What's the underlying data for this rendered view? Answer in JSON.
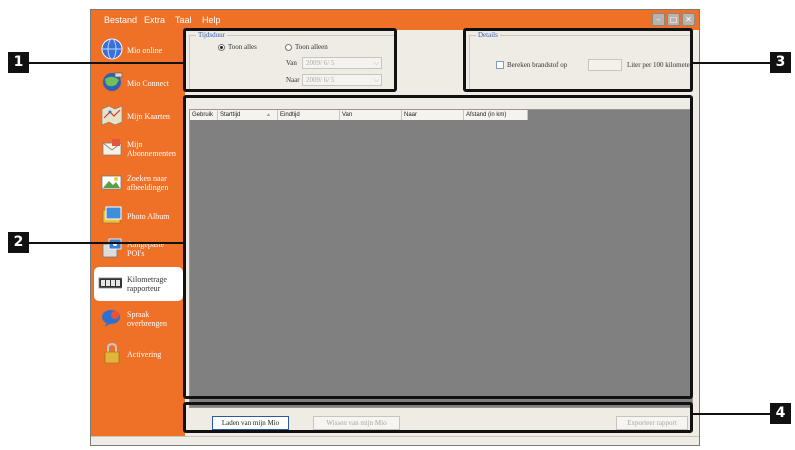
{
  "menubar": {
    "items": [
      "Bestand",
      "Extra",
      "Taal",
      "Help"
    ]
  },
  "sidebar": {
    "items": [
      {
        "label": "Mio online",
        "icon": "globe-icon"
      },
      {
        "label": "Mio Connect",
        "icon": "satellite-globe-icon"
      },
      {
        "label": "Mijn Kaarten",
        "icon": "map-icon"
      },
      {
        "label": "Mijn\nAbonnementen",
        "icon": "envelope-icon"
      },
      {
        "label": "Zoeken naar\nafbeeldingen",
        "icon": "photo-search-icon"
      },
      {
        "label": "Photo Album",
        "icon": "photo-album-icon"
      },
      {
        "label": "Aangepaste\nPOI's",
        "icon": "poi-icon"
      },
      {
        "label": "Kilometrage\nrapporteur",
        "icon": "odometer-icon",
        "active": true
      },
      {
        "label": "Spraak\noverbrengen",
        "icon": "speech-bubble-icon"
      },
      {
        "label": "Activering",
        "icon": "padlock-icon"
      }
    ]
  },
  "filter": {
    "legend": "Tijdsduur",
    "show_all": "Toon alles",
    "show_only": "Toon alleen",
    "from_label": "Van",
    "to_label": "Naar",
    "from_date": "2009/ 6/ 5",
    "to_date": "2009/ 6/ 5",
    "selected": "show_all"
  },
  "options": {
    "legend": "Details",
    "fuel_label": "Bereken brandstof op",
    "fuel_value": "",
    "unit_label": "Liter per 100 kilometer",
    "fuel_checked": false
  },
  "table": {
    "columns": [
      "Gebruik",
      "Starttijd",
      "Eindtijd",
      "Van",
      "Naar",
      "Afstand (in km)"
    ],
    "rows": []
  },
  "buttons": {
    "load": "Laden van mijn Mio",
    "clear": "Wissen van mijn Mio",
    "export": "Exporteer rapport"
  },
  "callouts": [
    "1",
    "2",
    "3",
    "4"
  ],
  "colors": {
    "accent": "#ef7027",
    "grid_background": "#808080",
    "callout": "#111111"
  }
}
